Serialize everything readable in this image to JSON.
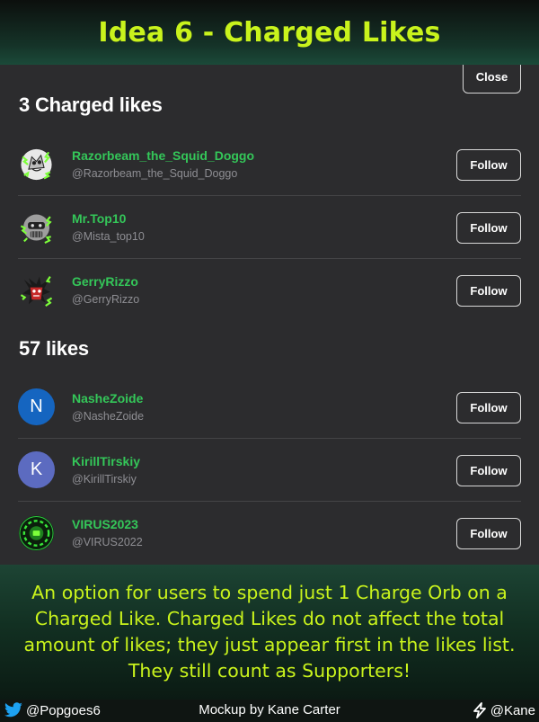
{
  "header": {
    "title": "Idea 6 - Charged Likes"
  },
  "dialog": {
    "close_label": "Close",
    "charged_section": {
      "title": "3 Charged likes",
      "users": [
        {
          "name": "Razorbeam_the_Squid_Doggo",
          "handle": "@Razorbeam_the_Squid_Doggo",
          "follow_label": "Follow",
          "avatar": "charged-sketch-avatar"
        },
        {
          "name": "Mr.Top10",
          "handle": "@Mista_top10",
          "follow_label": "Follow",
          "avatar": "charged-robot-avatar"
        },
        {
          "name": "GerryRizzo",
          "handle": "@GerryRizzo",
          "follow_label": "Follow",
          "avatar": "charged-red-character-avatar"
        }
      ]
    },
    "likes_section": {
      "title": "57 likes",
      "users": [
        {
          "name": "NasheZoide",
          "handle": "@NasheZoide",
          "follow_label": "Follow",
          "initial": "N",
          "avatar_color": "#1565c0"
        },
        {
          "name": "KirillTirskiy",
          "handle": "@KirillTirskiy",
          "follow_label": "Follow",
          "initial": "K",
          "avatar_color": "#5c6bc0"
        },
        {
          "name": "VIRUS2023",
          "handle": "@VIRUS2022",
          "follow_label": "Follow",
          "avatar": "green-virus-avatar"
        }
      ]
    }
  },
  "caption": "An option for users to spend just 1 Charge Orb on a Charged Like. Charged Likes do not affect the total amount of likes; they just appear first in the likes list. They still count as Supporters!",
  "footer": {
    "twitter_handle": "@Popgoes6",
    "credit": "Mockup by Kane Carter",
    "right_handle": "@Kane",
    "left_icon": "twitter-bird-icon",
    "right_icon": "lightning-bolt-icon"
  },
  "colors": {
    "title_accent": "#c9f31c",
    "username_green": "#34c759",
    "panel_bg": "#2c2c2e",
    "charge_green": "#7dff3a"
  }
}
